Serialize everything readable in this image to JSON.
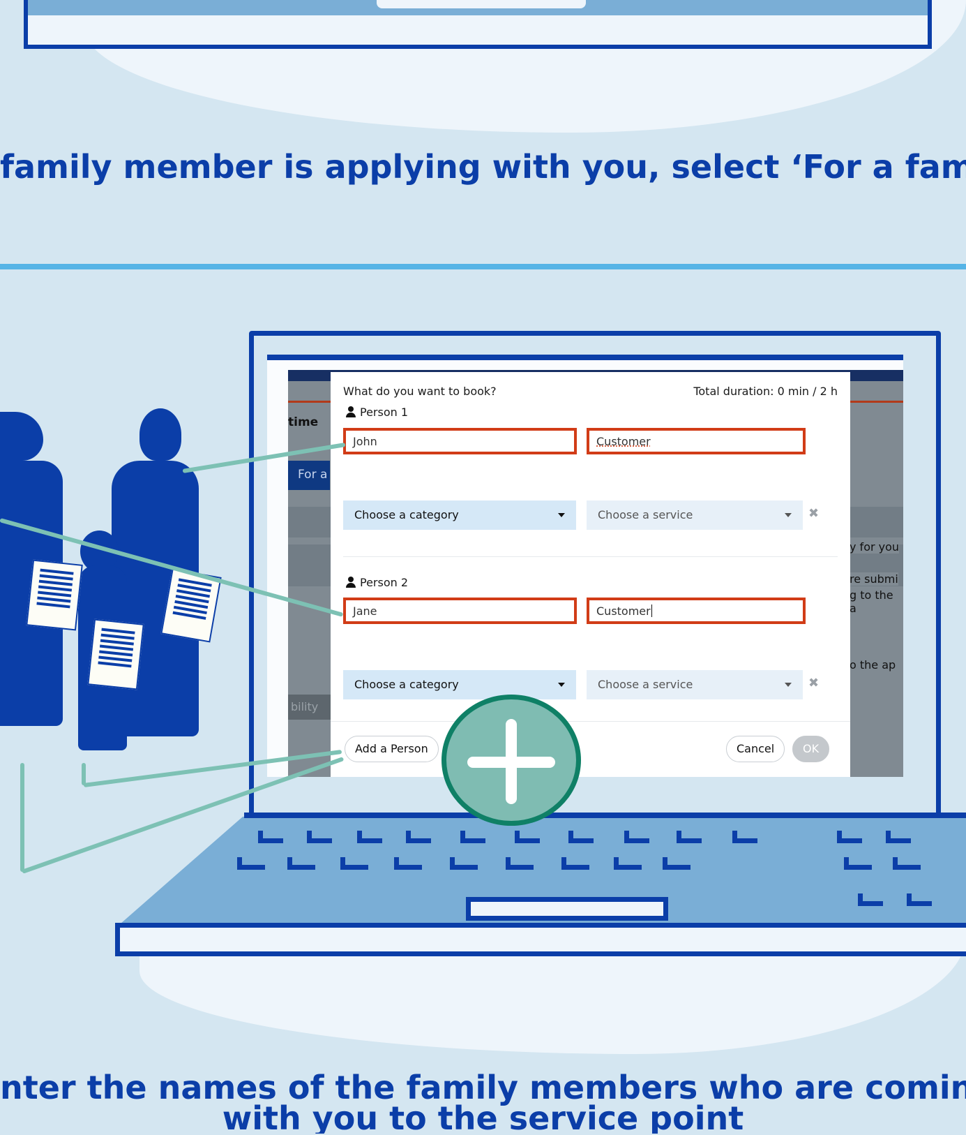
{
  "captions": {
    "top": "family member is applying with you, select ‘For a fami",
    "bottom_line1": "nter the names of the family members who are coming",
    "bottom_line2": "with you to the service point"
  },
  "background_app": {
    "time_label": "time",
    "for_a_button": "For a",
    "ility_label": "bility",
    "right_texts": [
      "y for you",
      "re submi",
      "g to the a",
      "o the ap"
    ]
  },
  "dialog": {
    "title": "What do you want to book?",
    "total_duration": "Total duration:  0 min / 2 h",
    "persons": [
      {
        "label": "Person 1",
        "first_name": "John",
        "last_name": "Customer",
        "category_placeholder": "Choose a category",
        "service_placeholder": "Choose a service"
      },
      {
        "label": "Person 2",
        "first_name": "Jane",
        "last_name": "Customer",
        "category_placeholder": "Choose a category",
        "service_placeholder": "Choose a service"
      }
    ],
    "add_person_label": "Add a Person",
    "cancel_label": "Cancel",
    "ok_label": "OK",
    "remove_icon": "✖"
  },
  "icons": [
    "person-icon",
    "dropdown-caret-icon",
    "remove-icon",
    "add-person-plus-icon"
  ],
  "colors": {
    "brand_blue": "#0b3ea8",
    "background": "#d4e6f1",
    "invalid_border": "#d13c17",
    "teal_badge": "#7fbcb2",
    "divider": "#56b4e6"
  }
}
